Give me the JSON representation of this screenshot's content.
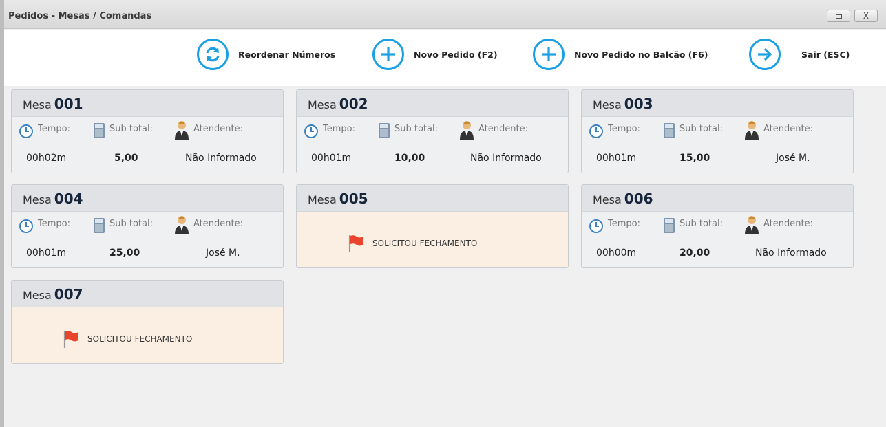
{
  "window": {
    "title": "Pedidos - Mesas / Comandas",
    "controls": {
      "restore": "□",
      "close": "X"
    }
  },
  "toolbar": {
    "reorder_label": "Reordenar Números",
    "new_order_label": "Novo Pedido (F2)",
    "new_counter_label": "Novo Pedido no Balcão (F6)",
    "exit_label": "Sair (ESC)"
  },
  "labels": {
    "mesa": "Mesa",
    "tempo": "Tempo:",
    "subtotal": "Sub total:",
    "atendente": "Atendente:",
    "closing": "SOLICITOU FECHAMENTO"
  },
  "tables": [
    {
      "number": "001",
      "status": "open",
      "time": "00h02m",
      "subtotal": "5,00",
      "attendant": "Não Informado"
    },
    {
      "number": "002",
      "status": "open",
      "time": "00h01m",
      "subtotal": "10,00",
      "attendant": "Não Informado"
    },
    {
      "number": "003",
      "status": "open",
      "time": "00h01m",
      "subtotal": "15,00",
      "attendant": "José M."
    },
    {
      "number": "004",
      "status": "open",
      "time": "00h01m",
      "subtotal": "25,00",
      "attendant": "José M."
    },
    {
      "number": "005",
      "status": "closing",
      "message": "SOLICITOU FECHAMENTO"
    },
    {
      "number": "006",
      "status": "open",
      "time": "00h00m",
      "subtotal": "20,00",
      "attendant": "Não Informado"
    },
    {
      "number": "007",
      "status": "closing",
      "message": "SOLICITOU FECHAMENTO"
    }
  ],
  "colors": {
    "accent": "#1ba1e2",
    "closing_bg": "#fbefe4",
    "flag": "#e8452c"
  },
  "icons": {
    "reorder": "refresh-icon",
    "new_order": "plus-icon",
    "new_counter": "plus-icon",
    "exit": "arrow-right-icon",
    "time": "clock-icon",
    "subtotal": "calculator-icon",
    "attendant": "waiter-icon",
    "closing": "flag-icon"
  }
}
